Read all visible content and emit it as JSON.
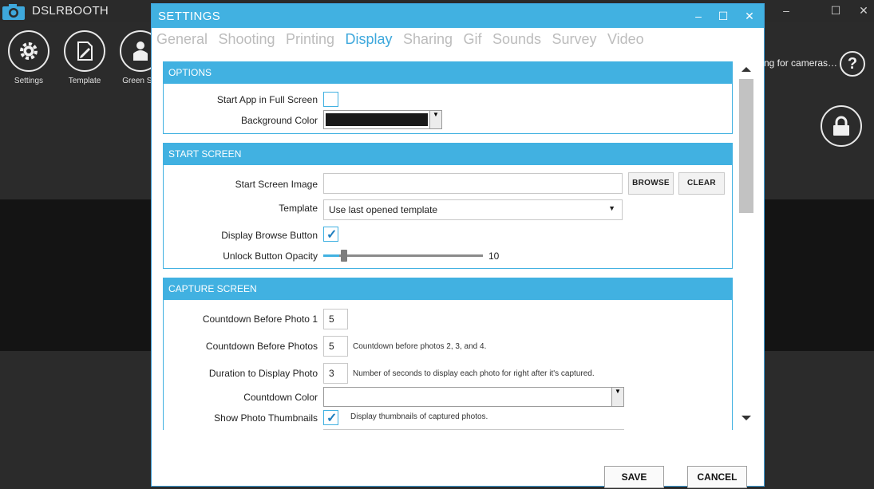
{
  "app": {
    "title": "DSLRBOOTH",
    "window_controls": {
      "minimize": "–",
      "maximize": "☐",
      "close": "✕"
    },
    "toolbar": [
      {
        "label": "Settings",
        "icon": "gear-icon"
      },
      {
        "label": "Template",
        "icon": "template-edit-icon"
      },
      {
        "label": "Green Scr",
        "icon": "person-icon"
      }
    ],
    "camera_status": "ng for cameras…",
    "help_label": "?"
  },
  "dialog": {
    "title": "SETTINGS",
    "controls": {
      "minimize": "–",
      "maximize": "☐",
      "close": "✕"
    },
    "tabs": [
      {
        "label": "General",
        "active": false
      },
      {
        "label": "Shooting",
        "active": false
      },
      {
        "label": "Printing",
        "active": false
      },
      {
        "label": "Display",
        "active": true
      },
      {
        "label": "Sharing",
        "active": false
      },
      {
        "label": "Gif",
        "active": false
      },
      {
        "label": "Sounds",
        "active": false
      },
      {
        "label": "Survey",
        "active": false
      },
      {
        "label": "Video",
        "active": false
      }
    ],
    "options": {
      "header": "OPTIONS",
      "full_screen_label": "Start App in Full Screen",
      "full_screen_checked": false,
      "bg_color_label": "Background Color",
      "bg_color_value": "#1a1a1a"
    },
    "start_screen": {
      "header": "START SCREEN",
      "image_label": "Start Screen Image",
      "image_value": "",
      "browse_label": "BROWSE",
      "clear_label": "CLEAR",
      "template_label": "Template",
      "template_value": "Use last opened template",
      "browse_btn_label": "Display Browse Button",
      "browse_btn_checked": true,
      "opacity_label": "Unlock Button Opacity",
      "opacity_value": "10",
      "opacity_fraction": 0.1
    },
    "capture_screen": {
      "header": "CAPTURE SCREEN",
      "countdown_first_label": "Countdown Before Photo 1",
      "countdown_first_value": "5",
      "countdown_photos_label": "Countdown Before Photos",
      "countdown_photos_value": "5",
      "countdown_photos_hint": "Countdown before photos 2, 3, and 4.",
      "duration_label": "Duration to Display Photo",
      "duration_value": "3",
      "duration_hint": "Number of seconds to display each photo for right after it's captured.",
      "countdown_color_label": "Countdown Color",
      "countdown_color_value": "",
      "thumbnails_label": "Show Photo Thumbnails",
      "thumbnails_checked": true,
      "thumbnails_hint": "Display thumbnails of captured photos."
    },
    "save_label": "SAVE",
    "cancel_label": "CANCEL"
  },
  "colors": {
    "accent": "#41b1e1",
    "tab_active": "#3ea8dc",
    "tab_inactive": "#bcbcbc"
  }
}
